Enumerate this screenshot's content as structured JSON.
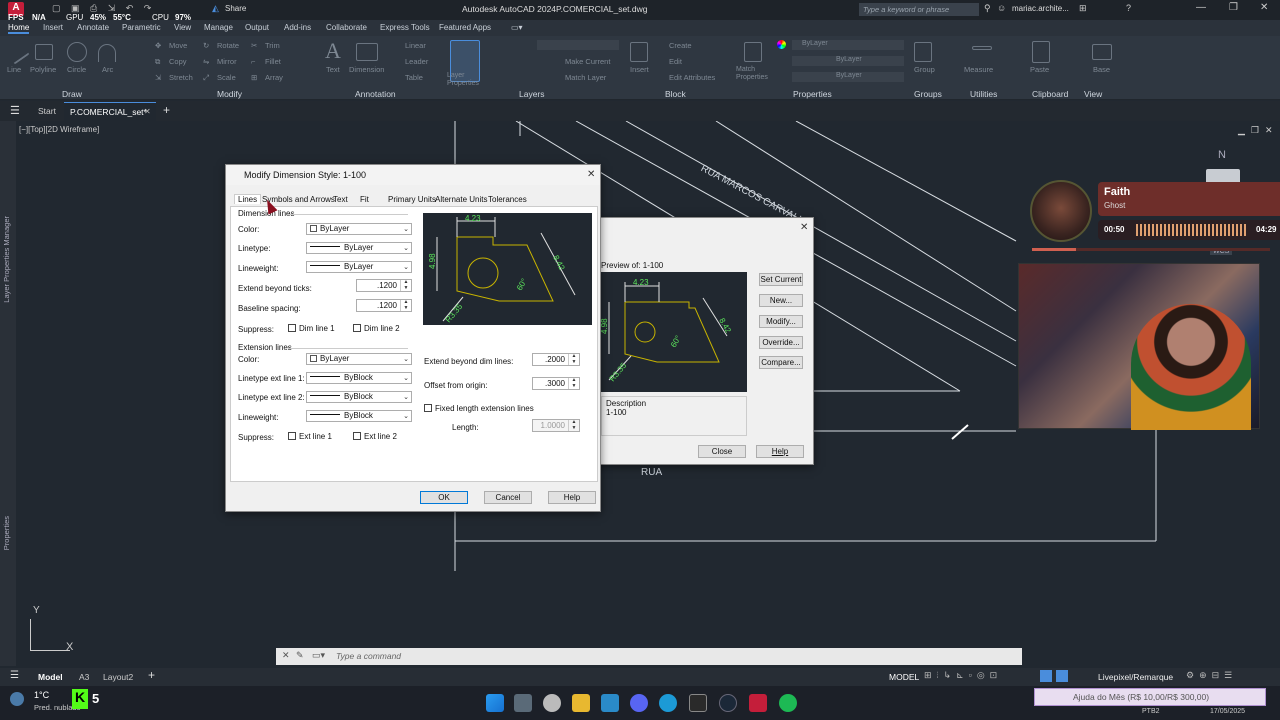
{
  "titlebar": {
    "fps_label": "FPS",
    "fps_value": "N/A",
    "gpu_label": "GPU",
    "gpu_value": "45%",
    "gpu_temp": "55°C",
    "cpu_label": "CPU",
    "cpu_value": "97%",
    "share": "Share",
    "app_title": "Autodesk AutoCAD 2024",
    "file_title": "P.COMERCIAL_set.dwg",
    "search_placeholder": "Type a keyword or phrase",
    "user": "mariac.archite..."
  },
  "ribbon_tabs": [
    "Home",
    "Insert",
    "Annotate",
    "Parametric",
    "View",
    "Manage",
    "Output",
    "Add-ins",
    "Collaborate",
    "Express Tools",
    "Featured Apps"
  ],
  "ribbon": {
    "draw": {
      "label": "Draw",
      "items": [
        "Line",
        "Polyline",
        "Circle",
        "Arc"
      ]
    },
    "modify": {
      "label": "Modify",
      "items": [
        "Move",
        "Rotate",
        "Trim",
        "Copy",
        "Mirror",
        "Fillet",
        "Stretch",
        "Scale",
        "Array"
      ]
    },
    "annotation": {
      "label": "Annotation",
      "items": [
        "Text",
        "Dimension",
        "Linear",
        "Leader",
        "Table"
      ]
    },
    "layers": {
      "label": "Layers",
      "items": [
        "Layer Properties",
        "Make Current",
        "Match Layer"
      ]
    },
    "block": {
      "label": "Block",
      "items": [
        "Insert",
        "Create",
        "Edit",
        "Edit Attributes"
      ]
    },
    "properties": {
      "label": "Properties",
      "items": [
        "Match Properties",
        "ByLayer",
        "ByLayer",
        "ByLayer"
      ]
    },
    "groups": {
      "label": "Groups",
      "items": [
        "Group"
      ]
    },
    "utilities": {
      "label": "Utilities",
      "items": [
        "Measure"
      ]
    },
    "clipboard": {
      "label": "Clipboard",
      "items": [
        "Paste"
      ]
    },
    "base": {
      "label": "View",
      "items": [
        "Base"
      ]
    }
  },
  "filetabs": {
    "start": "Start",
    "current": "P.COMERCIAL_set*"
  },
  "viewport_label": "[−][Top][2D Wireframe]",
  "side_panels": {
    "layer_props": "Layer Properties Manager",
    "properties": "Properties"
  },
  "canvas": {
    "street1": "RUA MARCOS CARVALHO",
    "street2": "RUA",
    "compass_n": "N",
    "wcs": "WCS",
    "ucs_y": "Y",
    "ucs_x": "X"
  },
  "dim_dialog": {
    "title": "Modify Dimension Style: 1-100",
    "tabs": [
      "Lines",
      "Symbols and Arrows",
      "Text",
      "Fit",
      "Primary Units",
      "Alternate Units",
      "Tolerances"
    ],
    "dim_lines_header": "Dimension lines",
    "color_label": "Color:",
    "color_value": "ByLayer",
    "linetype_label": "Linetype:",
    "linetype_value": "ByLayer",
    "lineweight_label": "Lineweight:",
    "lineweight_value": "ByLayer",
    "extend_ticks_label": "Extend beyond ticks:",
    "extend_ticks_value": ".1200",
    "baseline_label": "Baseline spacing:",
    "baseline_value": ".1200",
    "suppress_label": "Suppress:",
    "dim_line1": "Dim line 1",
    "dim_line2": "Dim line 2",
    "ext_lines_header": "Extension lines",
    "ext_color_label": "Color:",
    "ext_color_value": "ByLayer",
    "ext_lt1_label": "Linetype ext line 1:",
    "ext_lt1_value": "ByBlock",
    "ext_lt2_label": "Linetype ext line 2:",
    "ext_lt2_value": "ByBlock",
    "ext_lw_label": "Lineweight:",
    "ext_lw_value": "ByBlock",
    "ext_suppress_label": "Suppress:",
    "ext_line1": "Ext line 1",
    "ext_line2": "Ext line 2",
    "extend_dim_label": "Extend beyond dim lines:",
    "extend_dim_value": ".2000",
    "offset_label": "Offset from origin:",
    "offset_value": ".3000",
    "fixed_length": "Fixed length extension lines",
    "length_label": "Length:",
    "length_value": "1.0000",
    "ok": "OK",
    "cancel": "Cancel",
    "help": "Help",
    "preview_dims": [
      "4.23",
      "4.98",
      "8.42",
      "60°",
      "R3.35"
    ]
  },
  "style_manager": {
    "preview_of": "Preview of: 1-100",
    "buttons": [
      "Set Current",
      "New...",
      "Modify...",
      "Override...",
      "Compare..."
    ],
    "description_label": "Description",
    "description_value": "1-100",
    "close": "Close",
    "help": "Help"
  },
  "music_widget": {
    "title": "Faith",
    "artist": "Ghost",
    "elapsed": "00:50",
    "total": "04:29"
  },
  "cmdline": {
    "placeholder": "Type a command"
  },
  "layout_tabs": [
    "Model",
    "A3",
    "Layout2"
  ],
  "status": {
    "model": "MODEL",
    "workspace": "Livepixel/Remarque"
  },
  "taskbar": {
    "weather_temp": "1°C",
    "weather_desc": "Pred. nublado",
    "k_badge": "5",
    "donation": "Ajuda do Mês (R$ 10,00/R$ 300,00)",
    "lang": "PTB2",
    "date": "17/05/2025"
  },
  "colors": {
    "accent": "#4a8ddc",
    "dim_green": "#5ce65c",
    "geometry_yellow": "#c8b400",
    "cursor_red": "#c41e3a"
  }
}
